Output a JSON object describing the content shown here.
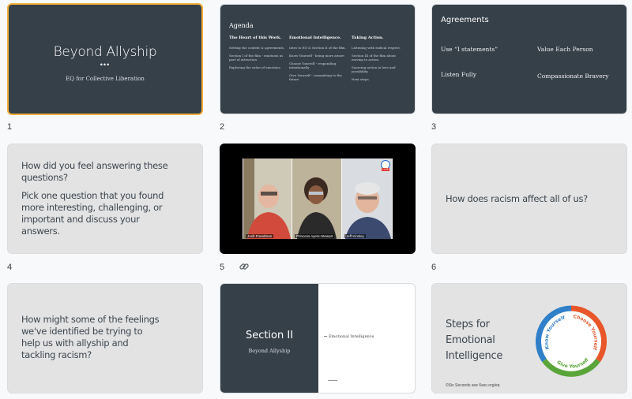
{
  "slides": [
    {
      "number": "1",
      "title": "Beyond Allyship",
      "dots": "•••",
      "subtitle": "EQ for Collective Liberation"
    },
    {
      "number": "2",
      "title": "Agenda",
      "columns": [
        {
          "heading": "The Heart of this Work.",
          "items": [
            "Setting the context & agreements.",
            "Section I of the film - emotions as part of attraction.",
            "Exploring the value of emotions."
          ]
        },
        {
          "heading": "Emotional Intelligence.",
          "items": [
            "Intro to EQ & Section II of the film.",
            "Know Yourself - being more aware",
            "Choose Yourself - responding intentionally",
            "Give Yourself - committing to the future"
          ]
        },
        {
          "heading": "Taking Action.",
          "items": [
            "Listening with radical respect.",
            "Section III of the film about moving to action.",
            "Sourcing action in love and possibility.",
            "Next steps."
          ]
        }
      ]
    },
    {
      "number": "3",
      "title": "Agreements",
      "items": [
        "Use “I statements”",
        "Value Each Person",
        "Listen Fully",
        "Compassionate Bravery"
      ]
    },
    {
      "number": "4",
      "lines": [
        "How did you feel answering these questions?",
        "Pick one question that you found more interesting, challenging, or important and discuss your answers."
      ]
    },
    {
      "number": "5",
      "participants": [
        "Josh Freedman",
        "Princess Ayers-Stewart",
        "Jeff Kinsley"
      ],
      "live_label": "LIVE"
    },
    {
      "number": "6",
      "text": "How does racism affect all of us?"
    },
    {
      "text": "How might some of the feelings we've identified be trying to help us with allyship and tackling racism?"
    },
    {
      "title": "Section II",
      "subtitle": "Beyond Allyship",
      "right_text": "Emotional Intelligence"
    },
    {
      "title": "Steps for Emotional Intelligence",
      "ring": [
        "Know Yourself",
        "Choose Yourself",
        "Give Yourself"
      ],
      "footer": "©Six Seconds see 6sec.org/eq"
    }
  ],
  "colors": {
    "dark_slide": "#364049",
    "gray_slide": "#e3e3e3",
    "selected_border": "#f3b13b",
    "ring_blue": "#2f7fc9",
    "ring_orange": "#e8562a",
    "ring_green": "#5aa53a"
  },
  "icons": {
    "slide5_badge": "link-icon"
  }
}
